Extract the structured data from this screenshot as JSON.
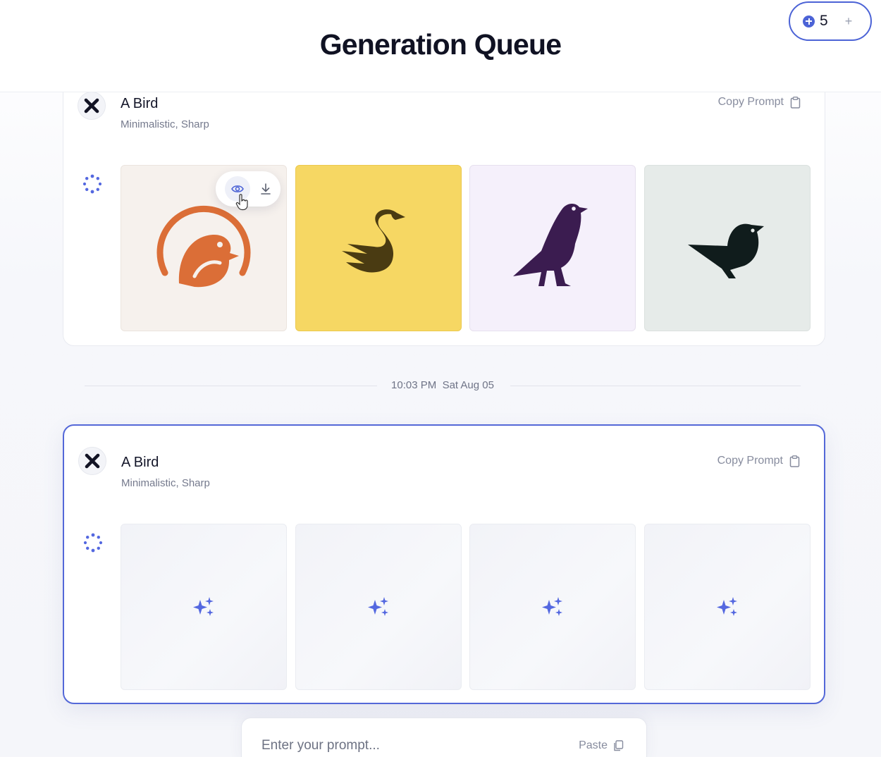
{
  "header": {
    "title": "Generation Queue"
  },
  "credits": {
    "count": "5",
    "icon": "credit-coin-icon",
    "add_icon": "plus-icon"
  },
  "queue": [
    {
      "title": "A Bird",
      "tags": "Minimalistic, Sharp",
      "copy_label": "Copy Prompt",
      "status": "complete",
      "images": [
        {
          "subject": "robin-in-circle-logo",
          "bg": "#f6f1ed",
          "fg": "#db6e37"
        },
        {
          "subject": "swan-logo",
          "bg": "#f6d763",
          "fg": "#4a3b12"
        },
        {
          "subject": "crow-logo",
          "bg": "#f5f0fb",
          "fg": "#3b1c50"
        },
        {
          "subject": "sparrow-logo",
          "bg": "#e6ebe9",
          "fg": "#101c1c"
        }
      ]
    },
    {
      "title": "A Bird",
      "tags": "Minimalistic, Sharp",
      "copy_label": "Copy Prompt",
      "status": "generating",
      "images": [
        {
          "subject": "sparkle-placeholder"
        },
        {
          "subject": "sparkle-placeholder"
        },
        {
          "subject": "sparkle-placeholder"
        },
        {
          "subject": "sparkle-placeholder"
        }
      ]
    }
  ],
  "timestamp": "10:03 PM  Sat Aug 05",
  "colors": {
    "accent": "#4c63d6",
    "sparkle": "#5468e0"
  },
  "prompt_bar": {
    "placeholder": "Enter your prompt...",
    "paste_label": "Paste"
  }
}
